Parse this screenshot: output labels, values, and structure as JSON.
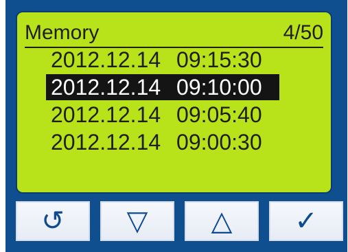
{
  "screen": {
    "title": "Memory",
    "counter": "4/50",
    "background_color": "#b8e21a",
    "text_color": "#1f1f1f"
  },
  "entries": [
    {
      "date": "2012.12.14",
      "time": "09:15:30",
      "selected": false
    },
    {
      "date": "2012.12.14",
      "time": "09:10:00",
      "selected": true
    },
    {
      "date": "2012.12.14",
      "time": "09:05:40",
      "selected": false
    },
    {
      "date": "2012.12.14",
      "time": "09:00:30",
      "selected": false
    }
  ],
  "buttons": [
    {
      "icon": "refresh-icon",
      "glyph": "↺"
    },
    {
      "icon": "down-icon",
      "glyph": "▽"
    },
    {
      "icon": "up-icon",
      "glyph": "△"
    },
    {
      "icon": "confirm-icon",
      "glyph": "✓"
    }
  ],
  "colors": {
    "device_frame": "#0f4f8f",
    "button_bg": "#eef2f8",
    "button_icon": "#0d4b91",
    "selection_bg": "#141414"
  }
}
